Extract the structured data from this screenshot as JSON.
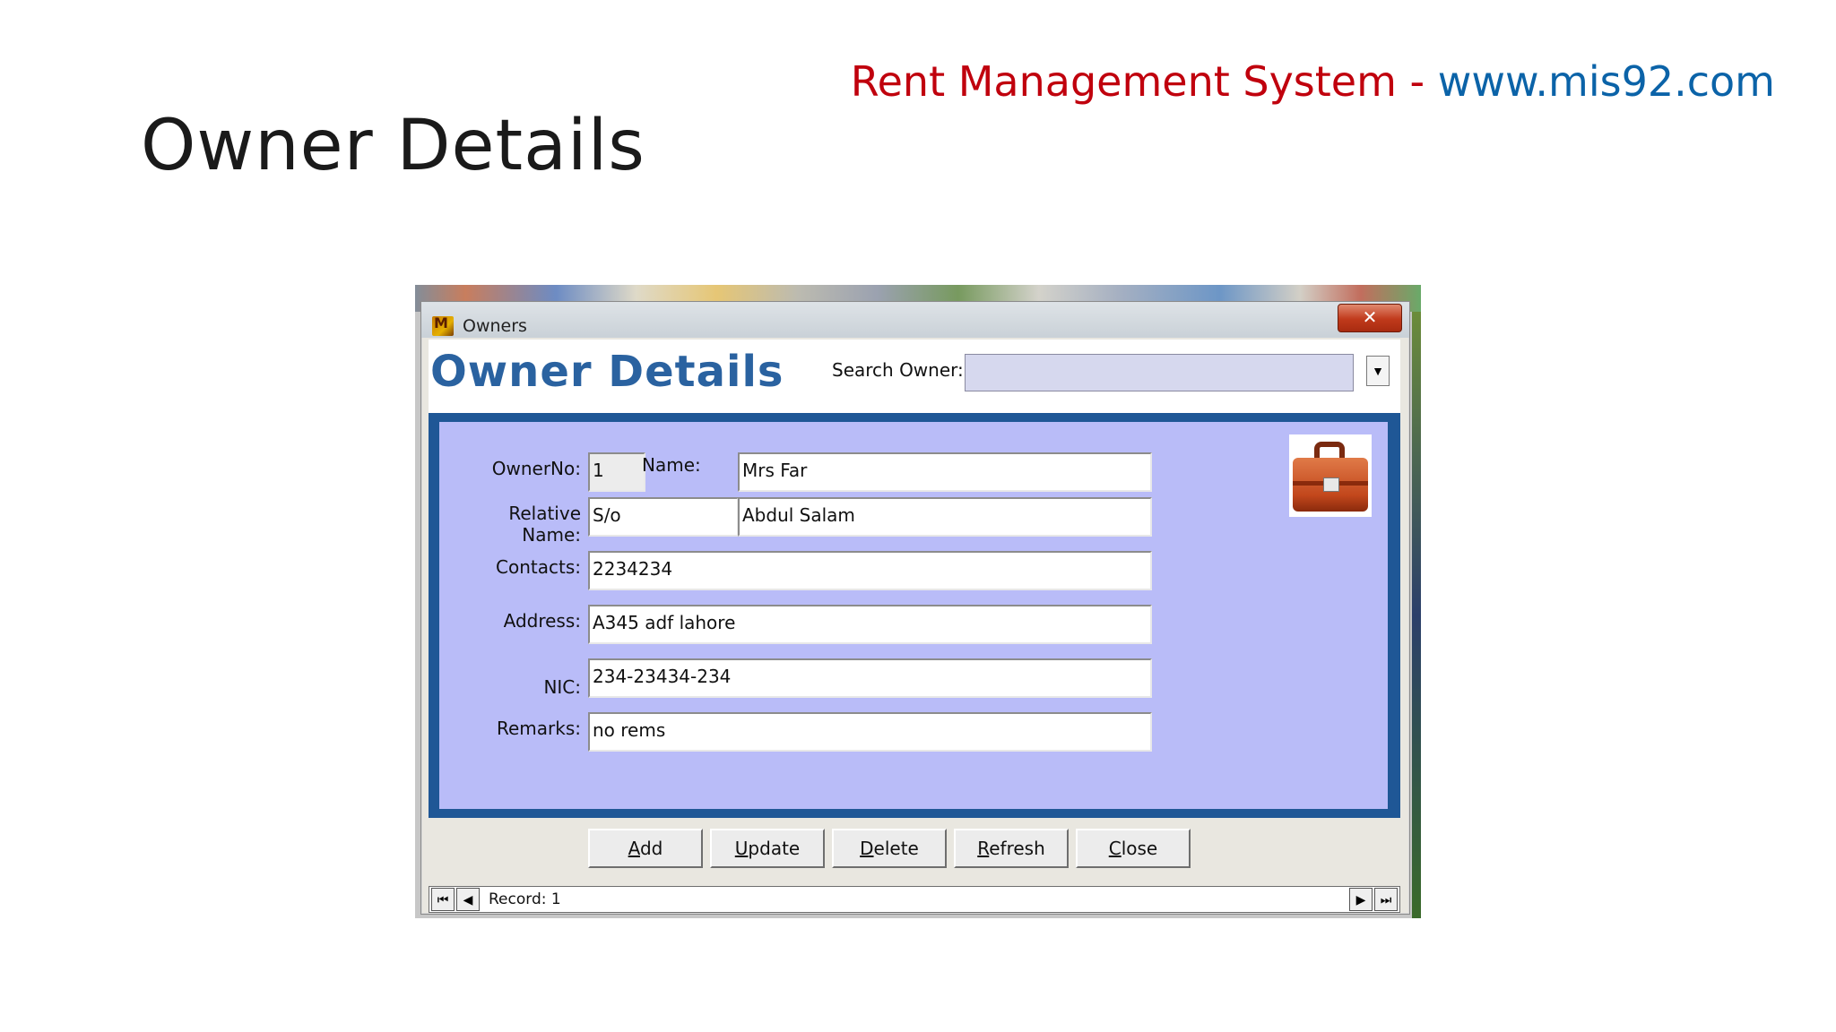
{
  "slide": {
    "title": "Owner Details",
    "brand_prefix": "Rent Management System - ",
    "brand_url": "www.mis92.com"
  },
  "window": {
    "title": "Owners",
    "close_label": "✕"
  },
  "form": {
    "title": "Owner Details",
    "search_label": "Search Owner:",
    "search_value": "",
    "fields": {
      "owner_no_label": "OwnerNo:",
      "owner_no": "1",
      "name_label": "Name:",
      "name": "Mrs Far",
      "relative_label": "Relative Name:",
      "relation": "S/o",
      "relative_name": "Abdul Salam",
      "contacts_label": "Contacts:",
      "contacts": "2234234",
      "address_label": "Address:",
      "address": "A345 adf lahore",
      "nic_label": "NIC:",
      "nic": "234-23434-234",
      "remarks_label": "Remarks:",
      "remarks": "no rems"
    }
  },
  "buttons": [
    {
      "accel": "A",
      "rest": "dd"
    },
    {
      "accel": "U",
      "rest": "pdate"
    },
    {
      "accel": "D",
      "rest": "elete"
    },
    {
      "accel": "R",
      "rest": "efresh"
    },
    {
      "accel": "C",
      "rest": "lose"
    }
  ],
  "navigator": {
    "record_text": "Record: 1"
  },
  "icons": {
    "first": "first-record-icon",
    "prev": "previous-record-icon",
    "next": "next-record-icon",
    "last": "last-record-icon",
    "briefcase": "briefcase-icon"
  }
}
